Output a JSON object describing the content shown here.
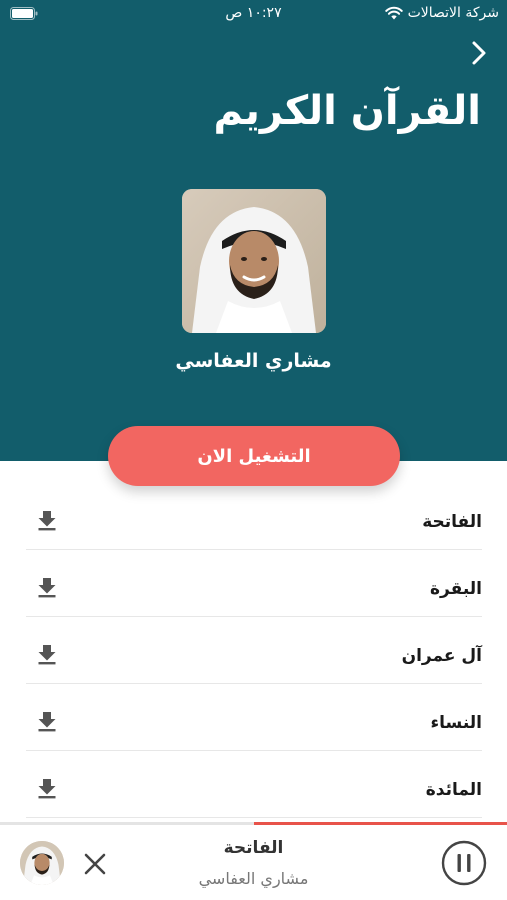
{
  "status_bar": {
    "carrier": "شركة الاتصالات",
    "time": "١٠:٢٧ ص"
  },
  "header": {
    "title": "القرآن الكريم",
    "back_icon": "chevron-right-icon"
  },
  "reciter": {
    "name": "مشاري العفاسي"
  },
  "play_now": {
    "label": "التشغيل الان"
  },
  "surahs": [
    {
      "name": "الفاتحة"
    },
    {
      "name": "البقرة"
    },
    {
      "name": "آل عمران"
    },
    {
      "name": "النساء"
    },
    {
      "name": "المائدة"
    }
  ],
  "player": {
    "title": "الفاتحة",
    "subtitle": "مشاري العفاسي",
    "progress": 0.5
  },
  "colors": {
    "header_bg": "#125d6b",
    "accent": "#f26661",
    "progress": "#e8534a"
  }
}
